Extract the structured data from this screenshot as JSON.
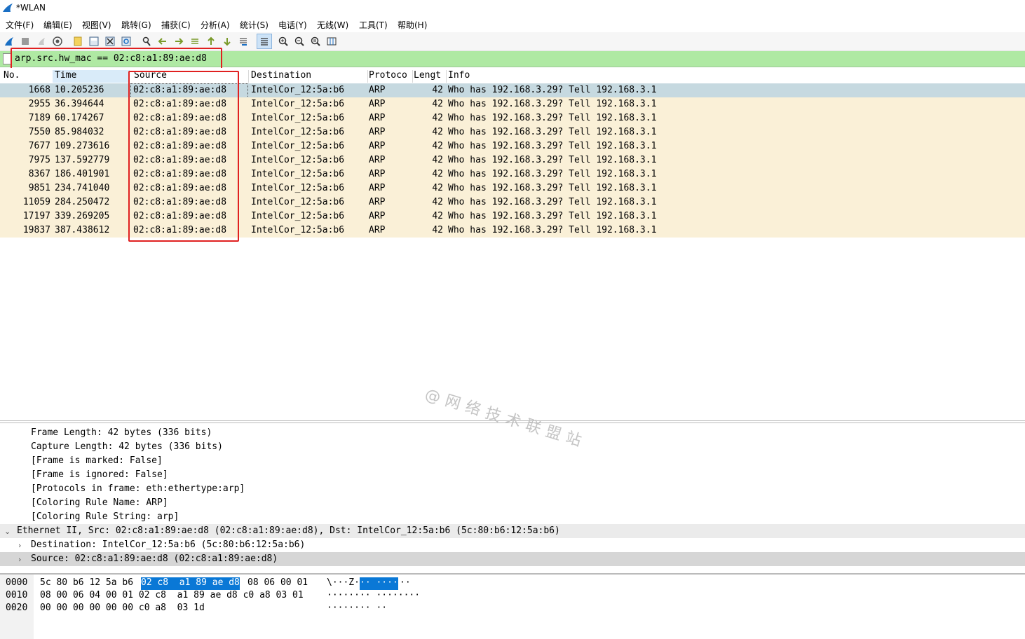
{
  "window": {
    "title": "*WLAN"
  },
  "menu": [
    "文件(F)",
    "编辑(E)",
    "视图(V)",
    "跳转(G)",
    "捕获(C)",
    "分析(A)",
    "统计(S)",
    "电话(Y)",
    "无线(W)",
    "工具(T)",
    "帮助(H)"
  ],
  "toolbar": {
    "icons": [
      "shark-fin-start-icon",
      "stop-capture-icon",
      "restart-capture-icon",
      "capture-options-icon",
      "open-file-icon",
      "save-file-icon",
      "close-file-icon",
      "reload-file-icon",
      "find-packet-icon",
      "go-back-icon",
      "go-forward-icon",
      "go-to-packet-icon",
      "first-packet-icon",
      "last-packet-icon",
      "auto-scroll-icon",
      "colorize-icon",
      "zoom-in-icon",
      "zoom-out-icon",
      "normal-size-icon",
      "resize-columns-icon"
    ]
  },
  "filter": {
    "value": "arp.src.hw_mac == 02:c8:a1:89:ae:d8",
    "bg_color": "#afe9a3"
  },
  "packet_list": {
    "columns": [
      "No.",
      "Time",
      "Source",
      "Destination",
      "Protoco",
      "Lengt",
      "Info"
    ],
    "rows": [
      {
        "no": "1668",
        "time": "10.205236",
        "source": "02:c8:a1:89:ae:d8",
        "destination": "IntelCor_12:5a:b6",
        "protocol": "ARP",
        "length": "42",
        "info": "Who has 192.168.3.29? Tell 192.168.3.1"
      },
      {
        "no": "2955",
        "time": "36.394644",
        "source": "02:c8:a1:89:ae:d8",
        "destination": "IntelCor_12:5a:b6",
        "protocol": "ARP",
        "length": "42",
        "info": "Who has 192.168.3.29? Tell 192.168.3.1"
      },
      {
        "no": "7189",
        "time": "60.174267",
        "source": "02:c8:a1:89:ae:d8",
        "destination": "IntelCor_12:5a:b6",
        "protocol": "ARP",
        "length": "42",
        "info": "Who has 192.168.3.29? Tell 192.168.3.1"
      },
      {
        "no": "7550",
        "time": "85.984032",
        "source": "02:c8:a1:89:ae:d8",
        "destination": "IntelCor_12:5a:b6",
        "protocol": "ARP",
        "length": "42",
        "info": "Who has 192.168.3.29? Tell 192.168.3.1"
      },
      {
        "no": "7677",
        "time": "109.273616",
        "source": "02:c8:a1:89:ae:d8",
        "destination": "IntelCor_12:5a:b6",
        "protocol": "ARP",
        "length": "42",
        "info": "Who has 192.168.3.29? Tell 192.168.3.1"
      },
      {
        "no": "7975",
        "time": "137.592779",
        "source": "02:c8:a1:89:ae:d8",
        "destination": "IntelCor_12:5a:b6",
        "protocol": "ARP",
        "length": "42",
        "info": "Who has 192.168.3.29? Tell 192.168.3.1"
      },
      {
        "no": "8367",
        "time": "186.401901",
        "source": "02:c8:a1:89:ae:d8",
        "destination": "IntelCor_12:5a:b6",
        "protocol": "ARP",
        "length": "42",
        "info": "Who has 192.168.3.29? Tell 192.168.3.1"
      },
      {
        "no": "9851",
        "time": "234.741040",
        "source": "02:c8:a1:89:ae:d8",
        "destination": "IntelCor_12:5a:b6",
        "protocol": "ARP",
        "length": "42",
        "info": "Who has 192.168.3.29? Tell 192.168.3.1"
      },
      {
        "no": "11059",
        "time": "284.250472",
        "source": "02:c8:a1:89:ae:d8",
        "destination": "IntelCor_12:5a:b6",
        "protocol": "ARP",
        "length": "42",
        "info": "Who has 192.168.3.29? Tell 192.168.3.1"
      },
      {
        "no": "17197",
        "time": "339.269205",
        "source": "02:c8:a1:89:ae:d8",
        "destination": "IntelCor_12:5a:b6",
        "protocol": "ARP",
        "length": "42",
        "info": "Who has 192.168.3.29? Tell 192.168.3.1"
      },
      {
        "no": "19837",
        "time": "387.438612",
        "source": "02:c8:a1:89:ae:d8",
        "destination": "IntelCor_12:5a:b6",
        "protocol": "ARP",
        "length": "42",
        "info": "Who has 192.168.3.29? Tell 192.168.3.1"
      }
    ],
    "row_color": "#faf0d7",
    "selected_row_color": "#c6d9e0"
  },
  "watermark": "@网络技术联盟站",
  "details": {
    "lines": [
      {
        "text": "Frame Length: 42 bytes (336 bits)",
        "level": 2,
        "twisty": ""
      },
      {
        "text": "Capture Length: 42 bytes (336 bits)",
        "level": 2,
        "twisty": ""
      },
      {
        "text": "[Frame is marked: False]",
        "level": 2,
        "twisty": ""
      },
      {
        "text": "[Frame is ignored: False]",
        "level": 2,
        "twisty": ""
      },
      {
        "text": "[Protocols in frame: eth:ethertype:arp]",
        "level": 2,
        "twisty": ""
      },
      {
        "text": "[Coloring Rule Name: ARP]",
        "level": 2,
        "twisty": ""
      },
      {
        "text": "[Coloring Rule String: arp]",
        "level": 2,
        "twisty": ""
      },
      {
        "text": "Ethernet II, Src: 02:c8:a1:89:ae:d8 (02:c8:a1:89:ae:d8), Dst: IntelCor_12:5a:b6 (5c:80:b6:12:5a:b6)",
        "level": 1,
        "twisty": "⌄"
      },
      {
        "text": "Destination: IntelCor_12:5a:b6 (5c:80:b6:12:5a:b6)",
        "level": 2,
        "twisty": "›"
      },
      {
        "text": "Source: 02:c8:a1:89:ae:d8 (02:c8:a1:89:ae:d8)",
        "level": 2,
        "twisty": "›"
      }
    ]
  },
  "bytes": {
    "lines": [
      {
        "offset": "0000",
        "hex_a": "5c 80 b6 12 5a b6",
        "hex_sel": "02 c8  a1 89 ae d8",
        "hex_b": "08 06 00 01",
        "ascii_a": "\\···Z·",
        "ascii_sel": "·· ····",
        "ascii_b": "··"
      },
      {
        "offset": "0010",
        "hex_a": "08 00 06 04 00 01 02 c8  a1 89 ae d8 c0 a8 03 01",
        "hex_sel": "",
        "hex_b": "",
        "ascii_a": "········ ········",
        "ascii_sel": "",
        "ascii_b": ""
      },
      {
        "offset": "0020",
        "hex_a": "00 00 00 00 00 00 c0 a8  03 1d",
        "hex_sel": "",
        "hex_b": "",
        "ascii_a": "········ ··",
        "ascii_sel": "",
        "ascii_b": ""
      }
    ],
    "highlight_color": "#0a78d6"
  }
}
